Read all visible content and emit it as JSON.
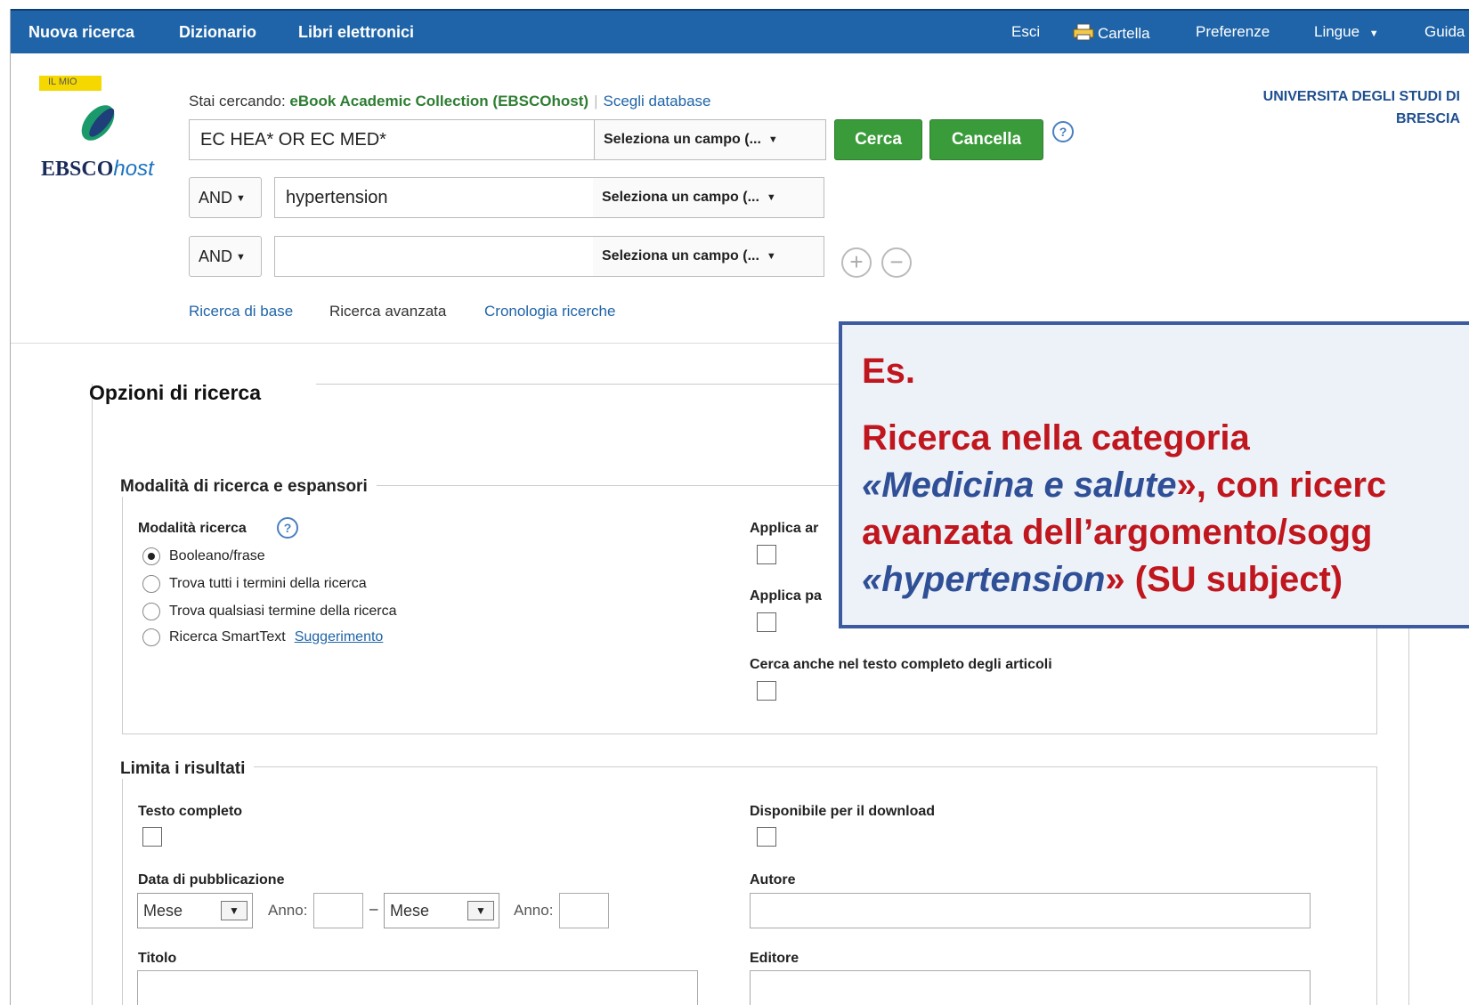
{
  "topbar": {
    "left_items": [
      "Nuova ricerca",
      "Dizionario",
      "Libri elettronici"
    ],
    "right_items": {
      "esci": "Esci",
      "cartella": "Cartella",
      "preferenze": "Preferenze",
      "lingue": "Lingue",
      "guida": "Guida"
    }
  },
  "logo": {
    "badge": "IL MIO",
    "brand_main": "EBSCO",
    "brand_suffix": "host"
  },
  "searching": {
    "prefix": "Stai cercando:",
    "database": "eBook Academic Collection (EBSCOhost)",
    "choose_db": "Scegli database"
  },
  "institution": {
    "line1": "UNIVERSITA DEGLI STUDI DI",
    "line2": "BRESCIA"
  },
  "search_rows": [
    {
      "operator": "",
      "query": "EC HEA* OR EC MED*",
      "field": "Seleziona un campo (..."
    },
    {
      "operator": "AND",
      "query": "hypertension",
      "field": "Seleziona un campo (..."
    },
    {
      "operator": "AND",
      "query": "",
      "field": "Seleziona un campo (..."
    }
  ],
  "buttons": {
    "search": "Cerca",
    "clear": "Cancella",
    "help": "?",
    "add_row": "+",
    "remove_row": "−"
  },
  "subnav": {
    "basic": "Ricerca di base",
    "advanced": "Ricerca avanzata",
    "history": "Cronologia ricerche"
  },
  "options": {
    "title": "Opzioni di ricerca",
    "modes_section": "Modalità di ricerca e espansori",
    "mode_label": "Modalità ricerca",
    "modes": [
      {
        "label": "Booleano/frase",
        "selected": true
      },
      {
        "label": "Trova tutti i termini della ricerca",
        "selected": false
      },
      {
        "label": "Trova qualsiasi termine della ricerca",
        "selected": false
      },
      {
        "label": "Ricerca SmartText",
        "selected": false
      }
    ],
    "smarttext_hint": "Suggerimento",
    "expander1": "Applica ar",
    "expander2": "Applica pa",
    "fulltext_search": "Cerca anche nel testo completo degli articoli"
  },
  "limits": {
    "section": "Limita i risultati",
    "full_text": "Testo completo",
    "downloadable": "Disponibile per il download",
    "pub_date": "Data di pubblicazione",
    "month_placeholder": "Mese",
    "year_label": "Anno:",
    "dash": "–",
    "author": "Autore",
    "title": "Titolo",
    "publisher": "Editore"
  },
  "callout": {
    "heading": "Es.",
    "line1": "Ricerca nella categoria",
    "line2_q_open": "«",
    "line2_em": "Medicina e salute",
    "line2_rest": "», con ricerc",
    "line3": "avanzata dell’argomento/sogg",
    "line4_q_open": "«",
    "line4_em": "hypertension",
    "line4_rest": "» (SU subject)"
  }
}
